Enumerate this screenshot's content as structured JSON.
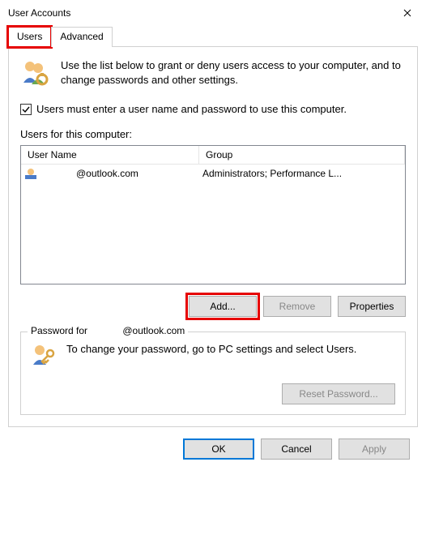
{
  "window": {
    "title": "User Accounts"
  },
  "tabs": {
    "users": "Users",
    "advanced": "Advanced"
  },
  "intro": "Use the list below to grant or deny users access to your computer, and to change passwords and other settings.",
  "checkbox": {
    "label": "Users must enter a user name and password to use this computer."
  },
  "list": {
    "label": "Users for this computer:",
    "columns": {
      "name": "User Name",
      "group": "Group"
    },
    "rows": [
      {
        "name_suffix": "@outlook.com",
        "group": "Administrators; Performance L..."
      }
    ]
  },
  "buttons": {
    "add": "Add...",
    "remove": "Remove",
    "properties": "Properties"
  },
  "password_box": {
    "title_prefix": "Password for",
    "title_suffix": "@outlook.com",
    "text": "To change your password, go to PC settings and select Users.",
    "reset": "Reset Password..."
  },
  "bottom": {
    "ok": "OK",
    "cancel": "Cancel",
    "apply": "Apply"
  }
}
